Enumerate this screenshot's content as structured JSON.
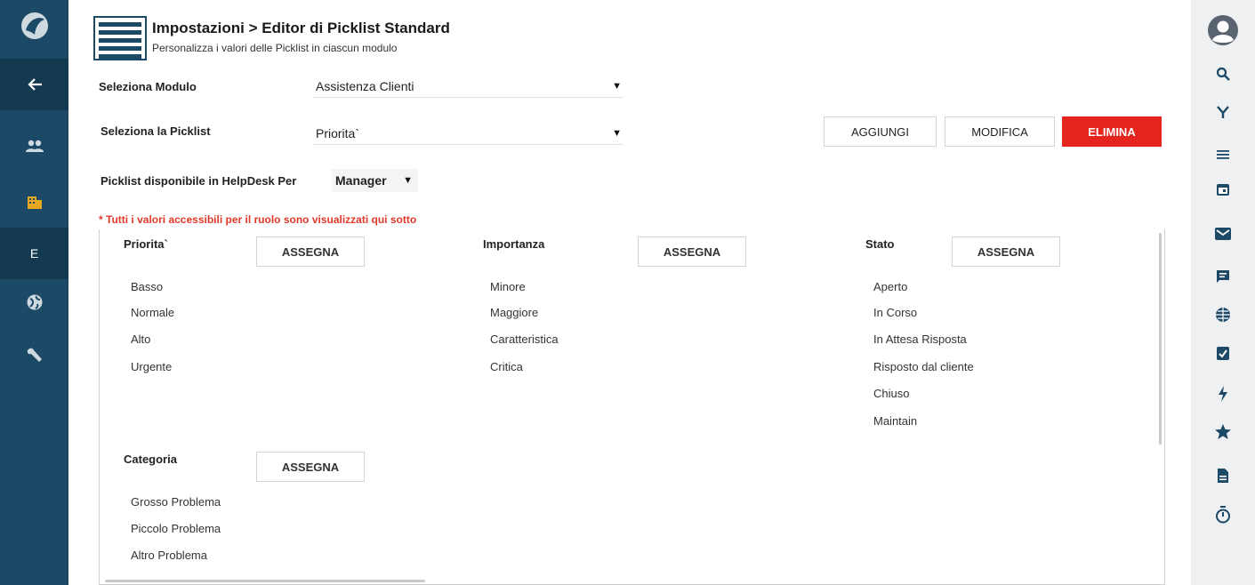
{
  "header": {
    "title": "Impostazioni > Editor di Picklist Standard",
    "subtitle": "Personalizza i valori delle Picklist in ciascun modulo"
  },
  "left_sidebar": {
    "items": [
      {
        "icon": "logo-icon"
      },
      {
        "icon": "back-arrow-icon"
      },
      {
        "icon": "contacts-icon"
      },
      {
        "icon": "organization-icon"
      },
      {
        "icon": "letter-e-icon",
        "label": "E"
      },
      {
        "icon": "globe-icon"
      },
      {
        "icon": "wrench-icon"
      }
    ]
  },
  "right_sidebar": {
    "icons": [
      "user-avatar-icon",
      "search-icon",
      "filter-icon",
      "list-icon",
      "calendar-icon",
      "mail-icon",
      "chat-icon",
      "globe-icon",
      "clipboard-check-icon",
      "lightning-icon",
      "star-icon",
      "document-icon",
      "timer-icon"
    ]
  },
  "form": {
    "module_label": "Seleziona Modulo",
    "module_value": "Assistenza Clienti",
    "picklist_label": "Seleziona la Picklist",
    "picklist_value": "Priorita`",
    "role_label": "Picklist disponibile in HelpDesk Per",
    "role_value": "Manager"
  },
  "actions": {
    "add": "AGGIUNGI",
    "edit": "MODIFICA",
    "delete": "ELIMINA"
  },
  "notice": "* Tutti i valori accessibili per il ruolo sono visualizzati qui sotto",
  "groups": [
    {
      "title": "Priorita`",
      "button": "ASSEGNA",
      "values": [
        "Basso",
        "Normale",
        "Alto",
        "Urgente"
      ]
    },
    {
      "title": "Importanza",
      "button": "ASSEGNA",
      "values": [
        "Minore",
        "Maggiore",
        "Caratteristica",
        "Critica"
      ]
    },
    {
      "title": "Stato",
      "button": "ASSEGNA",
      "values": [
        "Aperto",
        "In Corso",
        "In Attesa Risposta",
        "Risposto dal cliente",
        "Chiuso",
        "Maintain"
      ]
    },
    {
      "title": "Categoria",
      "button": "ASSEGNA",
      "values": [
        "Grosso Problema",
        "Piccolo Problema",
        "Altro Problema"
      ]
    }
  ],
  "colors": {
    "sidebar": "#1c4a66",
    "danger": "#e52420",
    "notice": "#e23a2a"
  }
}
